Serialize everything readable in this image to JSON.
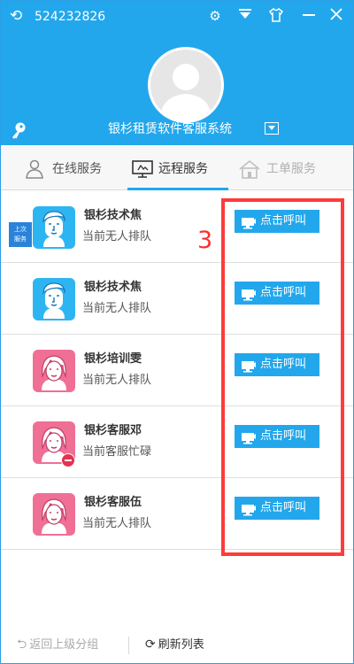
{
  "header": {
    "user_id": "524232826",
    "system_title": "银杉租赁软件客服系统"
  },
  "tabs": [
    {
      "label": "在线服务",
      "state": "normal"
    },
    {
      "label": "远程服务",
      "state": "active"
    },
    {
      "label": "工单服务",
      "state": "disabled"
    }
  ],
  "agents": [
    {
      "name": "银杉技术焦",
      "status": "当前无人排队",
      "button": "点击呼叫",
      "avatar": "male-agent-icon",
      "badge": "上次服务"
    },
    {
      "name": "银杉技术焦",
      "status": "当前无人排队",
      "button": "点击呼叫",
      "avatar": "male-agent-icon"
    },
    {
      "name": "银杉培训雯",
      "status": "当前无人排队",
      "button": "点击呼叫",
      "avatar": "female-agent-icon"
    },
    {
      "name": "银杉客服邓",
      "status": "当前客服忙碌",
      "button": "点击呼叫",
      "avatar": "female-agent-icon",
      "busy": true
    },
    {
      "name": "银杉客服伍",
      "status": "当前无人排队",
      "button": "点击呼叫",
      "avatar": "female-agent-icon"
    }
  ],
  "annotation": {
    "number": "3",
    "color": "#ff3b3b"
  },
  "footer": {
    "back_label": "返回上级分组",
    "refresh_label": "刷新列表"
  },
  "colors": {
    "accent": "#23a7ec",
    "male_avatar_bg": "#2db5f2",
    "female_avatar_bg": "#f06f95",
    "busy": "#e53350"
  }
}
